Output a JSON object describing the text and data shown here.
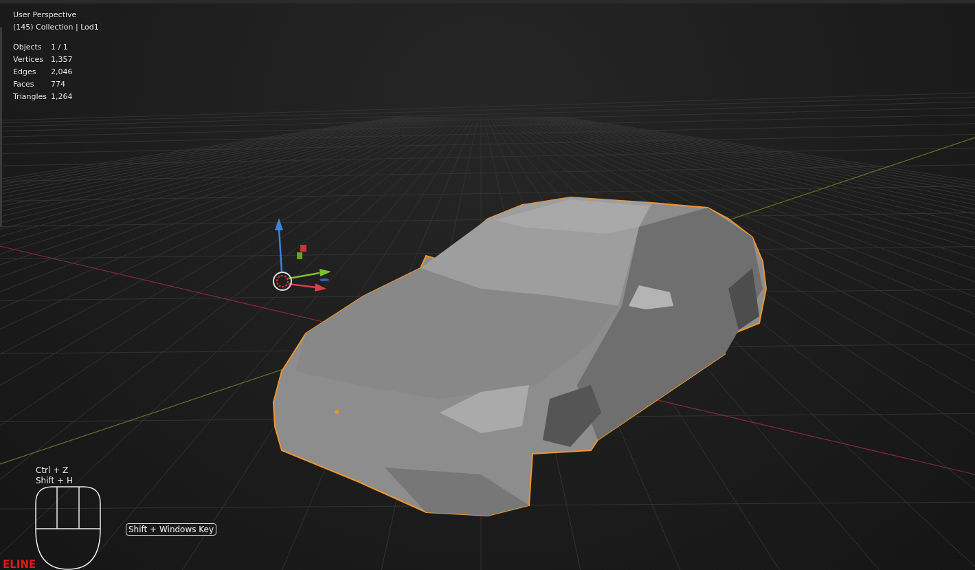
{
  "viewport": {
    "view_name": "User Perspective",
    "collection": "(145) Collection | Lod1",
    "stats": [
      {
        "label": "Objects",
        "value": "1 / 1"
      },
      {
        "label": "Vertices",
        "value": "1,357"
      },
      {
        "label": "Edges",
        "value": "2,046"
      },
      {
        "label": "Faces",
        "value": "774"
      },
      {
        "label": "Triangles",
        "value": "1,264"
      }
    ]
  },
  "keystrokes": {
    "lines": [
      "Ctrl + Z",
      "Shift + H"
    ],
    "badge": "Shift + Windows Key"
  },
  "corner_text": "ELINE"
}
